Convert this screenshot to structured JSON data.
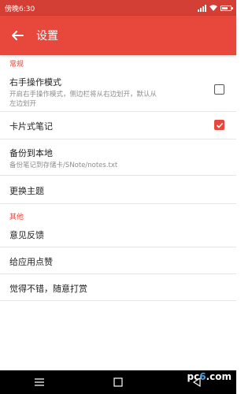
{
  "status_bar": {
    "time": "傍晚6:30",
    "battery_level": 0.7
  },
  "app_bar": {
    "title": "设置"
  },
  "sections": {
    "general": "常规",
    "other": "其他"
  },
  "items": {
    "right_hand": {
      "title": "右手操作模式",
      "subtitle_line1": "开启右手操作模式，侧边栏将从右边划开，默认从",
      "subtitle_line2": "左边划开",
      "checked": false
    },
    "card_notes": {
      "title": "卡片式笔记",
      "checked": true
    },
    "backup": {
      "title": "备份到本地",
      "subtitle": "备份笔记到存储卡/SNote/notes.txt"
    },
    "theme": {
      "title": "更换主题"
    },
    "feedback": {
      "title": "意见反馈"
    },
    "like": {
      "title": "给应用点赞"
    },
    "reward": {
      "title": "觉得不错，随意打赏"
    }
  },
  "watermark": {
    "prefix": "pc",
    "digit": "6",
    "suffix": ".com"
  },
  "colors": {
    "accent": "#e8473c",
    "status": "#d33f35"
  }
}
